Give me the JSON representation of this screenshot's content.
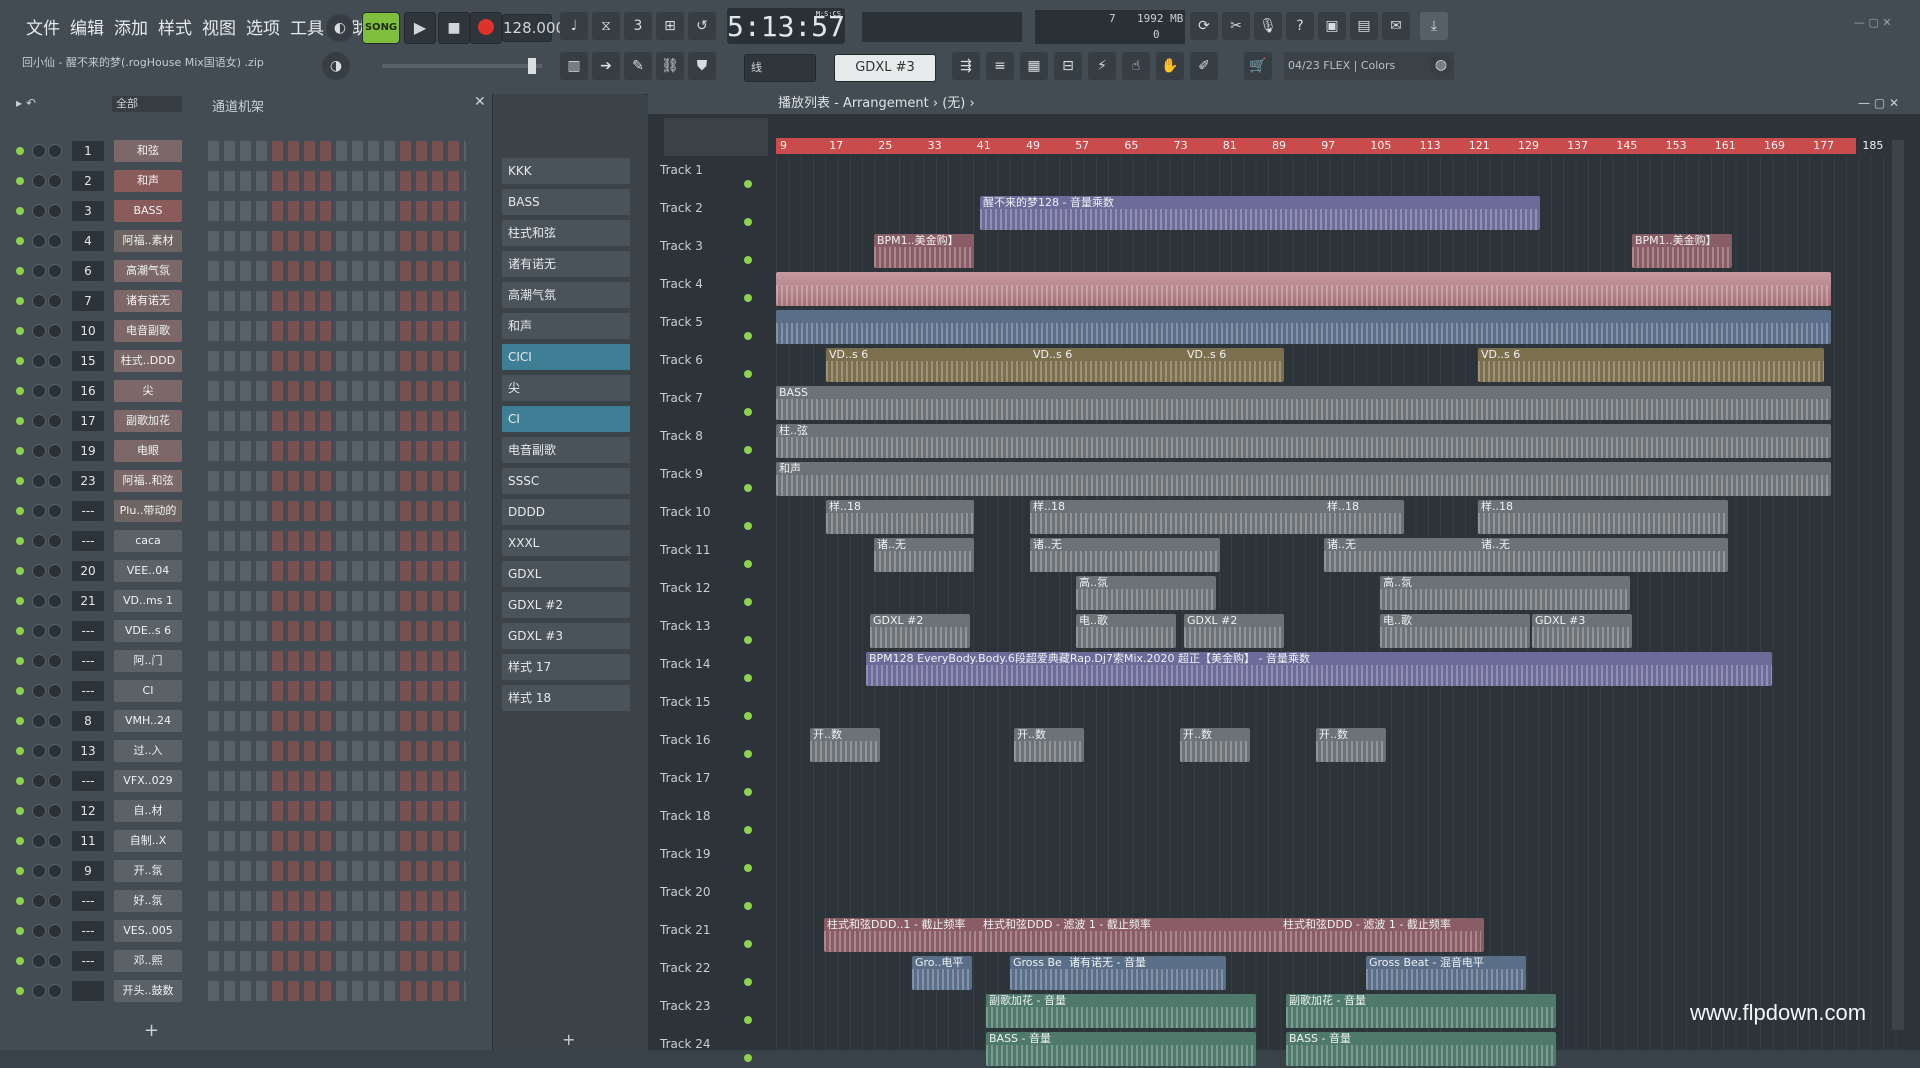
{
  "menu": [
    "文件",
    "编辑",
    "添加",
    "样式",
    "视图",
    "选项",
    "工具",
    "帮助"
  ],
  "transport": {
    "song_label": "SONG",
    "tempo": "128.000",
    "time": "5:13:57",
    "time_unit": "M:S:CS",
    "cpu_mem": "1992 MB",
    "cpu_num": "7",
    "cpu_zero": "0"
  },
  "project_title": "回小仙 - 醒不来的梦(.rogHouse Mix国语女) .zip",
  "snap_label": "线",
  "pattern_name": "GDXL #3",
  "hint_bar": "04/23  FLEX | Colors",
  "rack": {
    "filter": "全部",
    "title": "通道机架",
    "channels": [
      {
        "num": "1",
        "name": "和弦",
        "color": "#7c6868"
      },
      {
        "num": "2",
        "name": "和声",
        "color": "#8a5b5b"
      },
      {
        "num": "3",
        "name": "BASS",
        "color": "#8a5b5b"
      },
      {
        "num": "4",
        "name": "阿福..素材",
        "color": "#6e6464"
      },
      {
        "num": "6",
        "name": "高潮气氛",
        "color": "#7c6868"
      },
      {
        "num": "7",
        "name": "诸有诺无",
        "color": "#7c6868"
      },
      {
        "num": "10",
        "name": "电音副歌",
        "color": "#7c6868"
      },
      {
        "num": "15",
        "name": "柱式..DDD",
        "color": "#7c6868"
      },
      {
        "num": "16",
        "name": "尖",
        "color": "#7c6868"
      },
      {
        "num": "17",
        "name": "副歌加花",
        "color": "#7c6868"
      },
      {
        "num": "19",
        "name": "电眼",
        "color": "#7c6868"
      },
      {
        "num": "23",
        "name": "阿福..和弦",
        "color": "#7c6868"
      },
      {
        "num": "---",
        "name": "Plu..带动的",
        "color": "#6e6464"
      },
      {
        "num": "---",
        "name": "caca",
        "color": "#5a6167"
      },
      {
        "num": "20",
        "name": "VEE..04",
        "color": "#5a6167"
      },
      {
        "num": "21",
        "name": "VD..ms 1",
        "color": "#5a6167"
      },
      {
        "num": "---",
        "name": "VDE..s 6",
        "color": "#5a6167"
      },
      {
        "num": "---",
        "name": "阿..门",
        "color": "#5a6167"
      },
      {
        "num": "---",
        "name": "CI",
        "color": "#5a6167"
      },
      {
        "num": "8",
        "name": "VMH..24",
        "color": "#5a6167"
      },
      {
        "num": "13",
        "name": "过..入",
        "color": "#5a6167"
      },
      {
        "num": "---",
        "name": "VFX..029",
        "color": "#5a6167"
      },
      {
        "num": "12",
        "name": "自..材",
        "color": "#5a6167"
      },
      {
        "num": "11",
        "name": "自制..X",
        "color": "#5a6167"
      },
      {
        "num": "9",
        "name": "开..氛",
        "color": "#5a6167"
      },
      {
        "num": "---",
        "name": "好..氛",
        "color": "#5a6167"
      },
      {
        "num": "---",
        "name": "VES..005",
        "color": "#5a6167"
      },
      {
        "num": "---",
        "name": "邓..熙",
        "color": "#5a6167"
      },
      {
        "num": "",
        "name": "开头..鼓数",
        "color": "#5a6167"
      }
    ]
  },
  "patterns": [
    "KKK",
    "BASS",
    "柱式和弦",
    "诸有诺无",
    "高潮气氛",
    "和声",
    "CICI",
    "尖",
    "CI",
    "电音副歌",
    "SSSC",
    "DDDD",
    "XXXL",
    "GDXL",
    "GDXL #2",
    "GDXL #3",
    "样式 17",
    "样式 18"
  ],
  "playlist": {
    "title": "播放列表 - Arrangement › (无) ›",
    "ruler": [
      "9",
      "17",
      "25",
      "33",
      "41",
      "49",
      "57",
      "65",
      "73",
      "81",
      "89",
      "97",
      "105",
      "113",
      "121",
      "129",
      "137",
      "145",
      "153",
      "161",
      "169",
      "177",
      "185"
    ],
    "tracks": [
      "Track 1",
      "Track 2",
      "Track 3",
      "Track 4",
      "Track 5",
      "Track 6",
      "Track 7",
      "Track 8",
      "Track 9",
      "Track 10",
      "Track 11",
      "Track 12",
      "Track 13",
      "Track 14",
      "Track 15",
      "Track 16",
      "Track 17",
      "Track 18",
      "Track 19",
      "Track 20",
      "Track 21",
      "Track 22",
      "Track 23",
      "Track 24"
    ],
    "clip_labels": {
      "t2": "醒不来的梦128 - 音量乘数",
      "t3": "BPM1..美金购】",
      "t6": "VD..s 6",
      "t7": "BASS",
      "t8": "柱..弦",
      "t9": "和声",
      "t10": "样..18",
      "t11": "诸..无",
      "t12": "高..氛",
      "t13": "GDXL #2",
      "t13b": "电..歌",
      "t13c": "GDXL #3",
      "t14": "BPM128 EveryBody.Body.6段超爱典藏Rap.Dj7索Mix.2020 超正【美金购】 - 音量乘数",
      "t16": "开..数",
      "t21": "柱式和弦DDD..1 - 截止频率",
      "t21b": "柱式和弦DDD - 滤波 1 - 截止频率",
      "t22": "Gro..电平",
      "t22b": "Gross Be",
      "t22c": "诸有诺无 - 音量",
      "t22d": "Gross Beat - 混音电平",
      "t23": "副歌加花 - 音量",
      "t24": "BASS - 音量"
    }
  },
  "watermark": "www.flpdown.com"
}
